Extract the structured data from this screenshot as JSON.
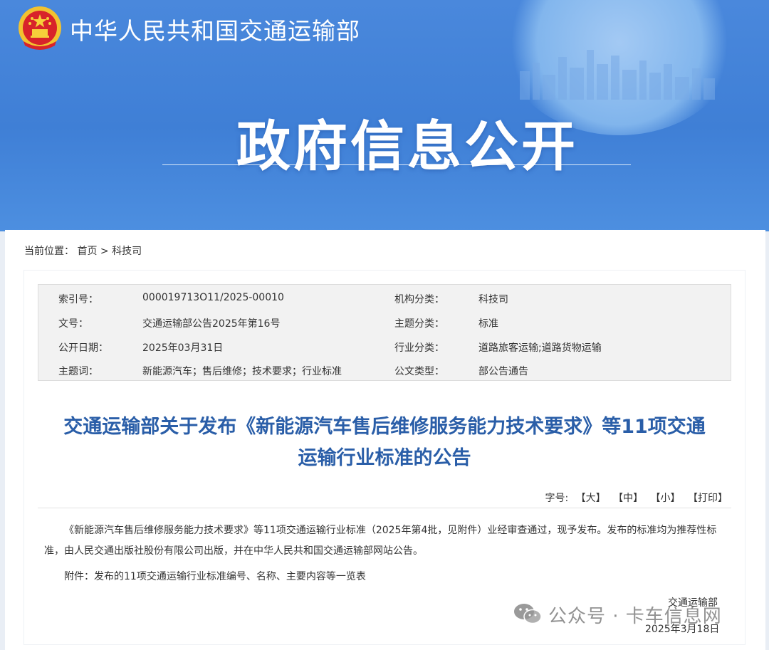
{
  "header": {
    "ministry_name": "中华人民共和国交通运输部",
    "banner_title": "政府信息公开",
    "emblem_icon": "national-emblem-icon",
    "colors": {
      "banner_blue": "#4484da",
      "title_blue": "#2a5ea8"
    }
  },
  "breadcrumb": {
    "label": "当前位置：",
    "home": "首页",
    "separator": ">",
    "current": "科技司"
  },
  "meta": {
    "rows": [
      {
        "k1": "索引号：",
        "v1": "000019713O11/2025-00010",
        "k2": "机构分类：",
        "v2": "科技司"
      },
      {
        "k1": "文号：",
        "v1": "交通运输部公告2025年第16号",
        "k2": "主题分类：",
        "v2": "标准"
      },
      {
        "k1": "公开日期：",
        "v1": "2025年03月31日",
        "k2": "行业分类：",
        "v2": "道路旅客运输;道路货物运输"
      },
      {
        "k1": "主题词：",
        "v1": "新能源汽车；售后维修；技术要求；行业标准",
        "k2": "公文类型：",
        "v2": "部公告通告"
      }
    ]
  },
  "article": {
    "title_line1": "交通运输部关于发布《新能源汽车售后维修服务能力技术要求》等11项交通",
    "title_line2": "运输行业标准的公告",
    "font_size_label": "字号:",
    "font_size_options": [
      "【大】",
      "【中】",
      "【小】",
      "【打印】"
    ],
    "paragraph1": "《新能源汽车售后维修服务能力技术要求》等11项交通运输行业标准（2025年第4批，见附件）业经审查通过，现予发布。发布的标准均为推荐性标准，由人民交通出版社股份有限公司出版，并在中华人民共和国交通运输部网站公告。",
    "attachment": "附件：发布的11项交通运输行业标准编号、名称、主要内容等一览表",
    "signature": "交通运输部",
    "date": "2025年3月18日"
  },
  "watermark": {
    "icon": "wechat-icon",
    "text": "公众号 · 卡车信息网"
  }
}
